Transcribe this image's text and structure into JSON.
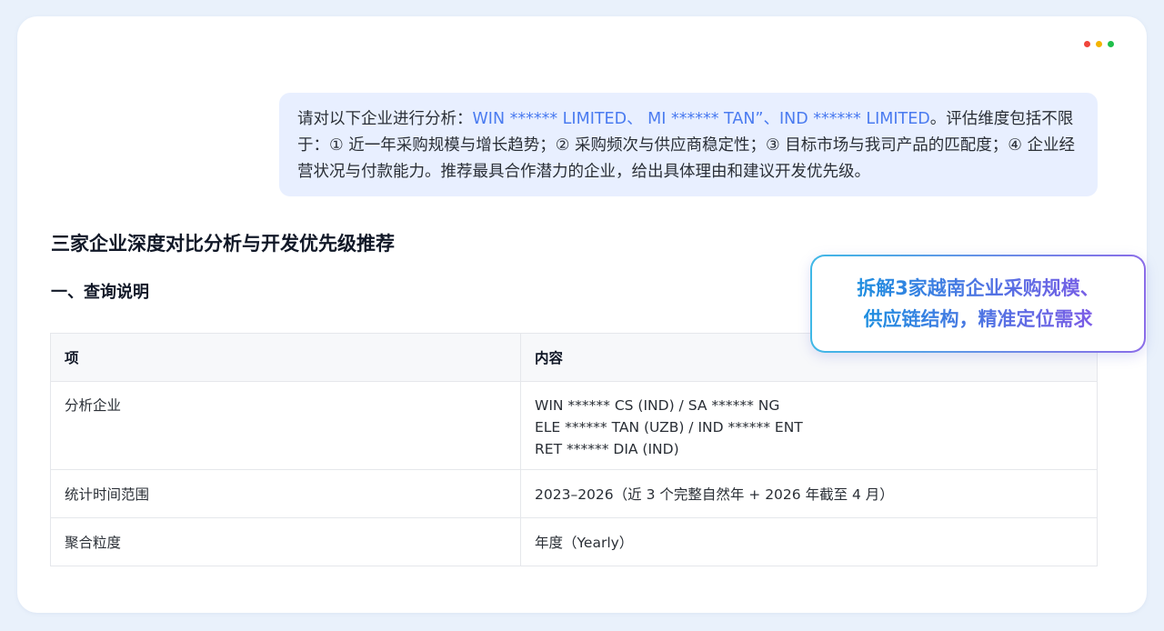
{
  "window_controls": [
    "red",
    "yellow",
    "green"
  ],
  "colors": {
    "highlight": "#4a7bf0",
    "bubble_bg": "#e8efff",
    "callout_gradient": [
      "#3fb8e6",
      "#8a6ce8"
    ]
  },
  "query": {
    "prefix": "请对以下企业进行分析：",
    "companies": "WIN ****** LIMITED、 MI ****** TAN”、IND ****** LIMITED",
    "suffix": "。评估维度包括不限于：① 近一年采购规模与增长趋势；② 采购频次与供应商稳定性；③ 目标市场与我司产品的匹配度；④ 企业经营状况与付款能力。推荐最具合作潜力的企业，给出具体理由和建议开发优先级。"
  },
  "title": "三家企业深度对比分析与开发优先级推荐",
  "section_1": "一、查询说明",
  "table": {
    "headers": [
      "项",
      "内容"
    ],
    "rows": [
      {
        "item": "分析企业",
        "lines": [
          "WIN ****** CS (IND) / SA ****** NG",
          "ELE ****** TAN (UZB) / IND ****** ENT",
          "RET ****** DIA (IND)"
        ]
      },
      {
        "item": "统计时间范围",
        "lines": [
          "2023–2026（近 3 个完整自然年 + 2026 年截至 4 月）"
        ]
      },
      {
        "item": "聚合粒度",
        "lines": [
          "年度（Yearly）"
        ]
      }
    ]
  },
  "callout": {
    "line1": "拆解3家越南企业采购规模、",
    "line2": "供应链结构，精准定位需求"
  }
}
